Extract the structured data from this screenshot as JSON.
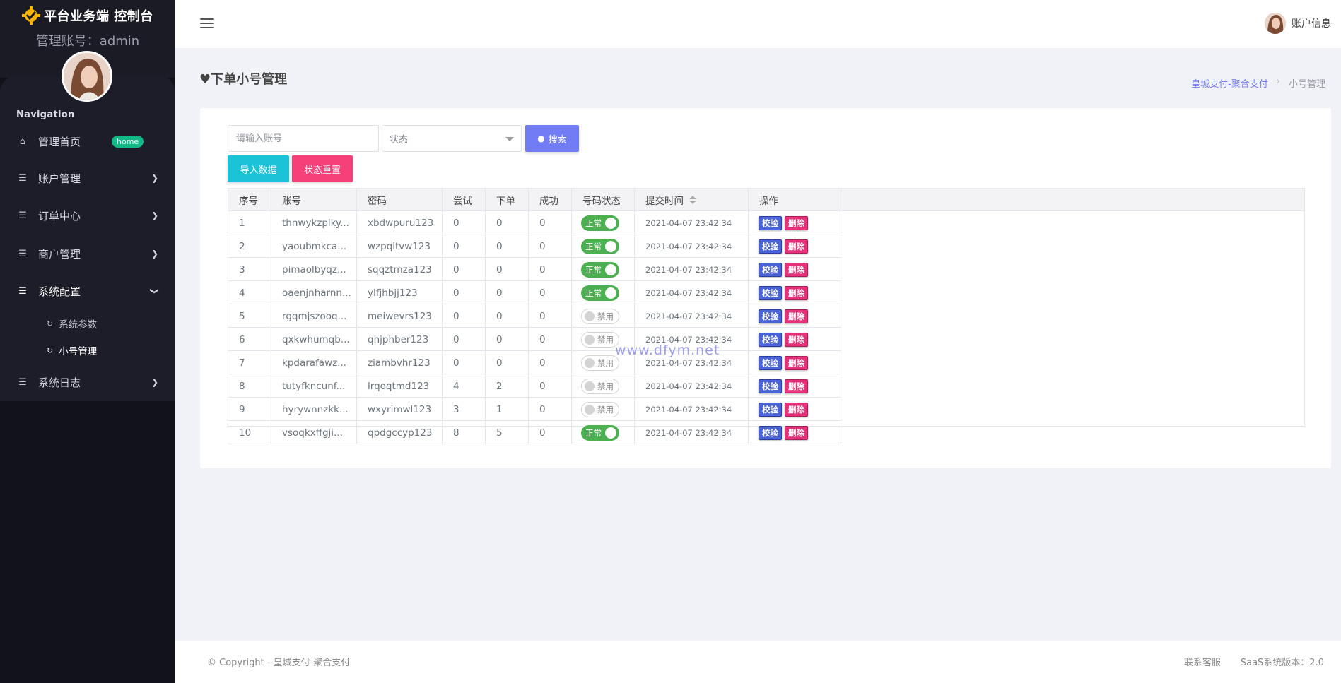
{
  "brand": {
    "title": "平台业务端 控制台",
    "account": "管理账号：admin"
  },
  "nav": {
    "heading": "Navigation",
    "home": {
      "label": "管理首页",
      "badge": "home"
    },
    "items": [
      {
        "label": "账户管理"
      },
      {
        "label": "订单中心"
      },
      {
        "label": "商户管理"
      },
      {
        "label": "系统配置"
      },
      {
        "label": "系统日志"
      }
    ],
    "sub_items": [
      {
        "label": "系统参数"
      },
      {
        "label": "小号管理"
      }
    ]
  },
  "topbar": {
    "account_label": "账户信息"
  },
  "page": {
    "title": "♥下单小号管理"
  },
  "breadcrumb": {
    "link": "皇城支付-聚合支付",
    "separator": "›",
    "current": "小号管理"
  },
  "filters": {
    "account_placeholder": "请输入账号",
    "status_placeholder": "状态",
    "search_label": "搜索",
    "import_label": "导入数据",
    "reset_label": "状态重置"
  },
  "table": {
    "columns": [
      "序号",
      "账号",
      "密码",
      "尝试",
      "下单",
      "成功",
      "号码状态",
      "提交时间",
      "操作"
    ],
    "verify_label": "校验",
    "delete_label": "删除",
    "rows": [
      {
        "no": "1",
        "account": "thnwykzplky...",
        "password": "xbdwpuru123",
        "tries": "0",
        "orders": "0",
        "success": "0",
        "status": "正常",
        "enabled": true,
        "time": "2021-04-07 23:42:34"
      },
      {
        "no": "2",
        "account": "yaoubmkca...",
        "password": "wzpqltvw123",
        "tries": "0",
        "orders": "0",
        "success": "0",
        "status": "正常",
        "enabled": true,
        "time": "2021-04-07 23:42:34"
      },
      {
        "no": "3",
        "account": "pimaolbyqz...",
        "password": "sqqztmza123",
        "tries": "0",
        "orders": "0",
        "success": "0",
        "status": "正常",
        "enabled": true,
        "time": "2021-04-07 23:42:34"
      },
      {
        "no": "4",
        "account": "oaenjnharnn...",
        "password": "ylfjhbjj123",
        "tries": "0",
        "orders": "0",
        "success": "0",
        "status": "正常",
        "enabled": true,
        "time": "2021-04-07 23:42:34"
      },
      {
        "no": "5",
        "account": "rgqmjszooq...",
        "password": "meiwevrs123",
        "tries": "0",
        "orders": "0",
        "success": "0",
        "status": "禁用",
        "enabled": false,
        "time": "2021-04-07 23:42:34"
      },
      {
        "no": "6",
        "account": "qxkwhumqb...",
        "password": "qhjphber123",
        "tries": "0",
        "orders": "0",
        "success": "0",
        "status": "禁用",
        "enabled": false,
        "time": "2021-04-07 23:42:34"
      },
      {
        "no": "7",
        "account": "kpdarafawz...",
        "password": "ziambvhr123",
        "tries": "0",
        "orders": "0",
        "success": "0",
        "status": "禁用",
        "enabled": false,
        "time": "2021-04-07 23:42:34"
      },
      {
        "no": "8",
        "account": "tutyfkncunf...",
        "password": "lrqoqtmd123",
        "tries": "4",
        "orders": "2",
        "success": "0",
        "status": "禁用",
        "enabled": false,
        "time": "2021-04-07 23:42:34"
      },
      {
        "no": "9",
        "account": "hyrywnnzkk...",
        "password": "wxyrimwl123",
        "tries": "3",
        "orders": "1",
        "success": "0",
        "status": "禁用",
        "enabled": false,
        "time": "2021-04-07 23:42:34"
      },
      {
        "no": "10",
        "account": "vsoqkxffgji...",
        "password": "qpdgccyp123",
        "tries": "8",
        "orders": "5",
        "success": "0",
        "status": "正常",
        "enabled": true,
        "time": "2021-04-07 23:42:34"
      }
    ]
  },
  "watermark": "www.dfym.net",
  "footer": {
    "copyright": "© Copyright - 皇城支付-聚合支付",
    "service": "联系客服",
    "version": "SaaS系统版本：2.0"
  },
  "colors": {
    "accent": "#727cf5",
    "sidebar": "#11121a",
    "success": "#4caf50",
    "danger": "#f5407a",
    "info": "#1bc3d8"
  }
}
